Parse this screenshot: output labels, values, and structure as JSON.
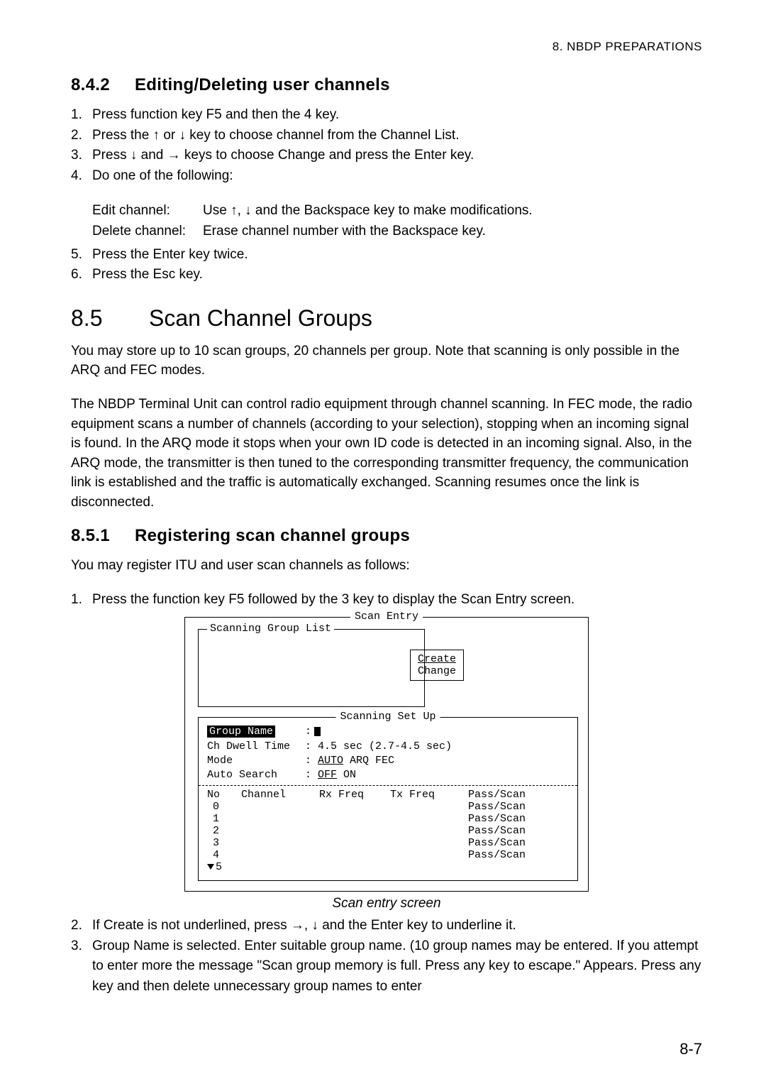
{
  "header": {
    "right": "8.  NBDP  PREPARATIONS"
  },
  "section842": {
    "num": "8.4.2",
    "title": "Editing/Deleting user channels",
    "steps": {
      "s1n": "1.",
      "s1t": "Press function key F5 and then the 4 key.",
      "s2n": "2.",
      "s2t": "Press the ↑ or ↓ key to choose channel from the Channel List.",
      "s3n": "3.",
      "s3t": "Press ↓ and → keys to choose Change and press the Enter key.",
      "s4n": "4.",
      "s4t": "Do one of the following:",
      "s5n": "5.",
      "s5t": "Press the Enter key twice.",
      "s6n": "6.",
      "s6t": "Press the Esc key."
    },
    "detail": {
      "edit_lbl": "Edit channel:",
      "edit_txt": "Use ↑, ↓ and the Backspace key to make modifications.",
      "del_lbl": "Delete channel:",
      "del_txt": "Erase channel number with the Backspace key."
    }
  },
  "section85": {
    "num": "8.5",
    "title": "Scan Channel Groups",
    "para1": "You may store up to 10 scan groups, 20 channels per group. Note that scanning is only possible in the ARQ and FEC modes.",
    "para2": "The NBDP Terminal Unit can control radio equipment through channel scanning. In FEC mode, the radio equipment scans a number of channels (according to your selection), stopping when an incoming signal is found. In the ARQ mode it stops when your own ID code is detected in an incoming signal. Also, in the ARQ mode, the transmitter is then tuned to the corresponding transmitter frequency, the communication link is established and the traffic is automatically exchanged. Scanning resumes once the link is disconnected."
  },
  "section851": {
    "num": "8.5.1",
    "title": "Registering scan channel groups",
    "intro": "You may register ITU and user scan channels as follows:",
    "steps": {
      "s1n": "1.",
      "s1t": "Press the function key F5 followed by the 3 key to display the Scan Entry screen.",
      "s2n": "2.",
      "s2t": "If Create is not underlined, press →, ↓ and the Enter key to underline it.",
      "s3n": "3.",
      "s3t": "Group Name is selected. Enter suitable group name. (10 group names may be entered. If you attempt to enter more the message \"Scan group memory is full. Press any key to escape.\" Appears. Press any key and then delete unnecessary group names to enter"
    }
  },
  "scan_entry": {
    "box_title": "Scan Entry",
    "group_list_title": "Scanning Group List",
    "create": "Create",
    "change": "Change",
    "setup_title": "Scanning Set Up",
    "group_name_lbl": "Group Name",
    "dwell_lbl": "Ch Dwell Time",
    "dwell_val": ": 4.5 sec (2.7-4.5 sec)",
    "mode_lbl": "Mode",
    "mode_colon": ": ",
    "mode_auto": "AUTO",
    "mode_rest": " ARQ FEC",
    "autosearch_lbl": "Auto Search",
    "autosearch_colon": ": ",
    "autosearch_off": "OFF",
    "autosearch_rest": " ON",
    "th_no": "No",
    "th_channel": "Channel",
    "th_rx": "Rx Freq",
    "th_tx": "Tx Freq",
    "th_ps": "Pass/Scan",
    "rows": [
      {
        "n": "0",
        "ps": "Pass/Scan"
      },
      {
        "n": "1",
        "ps": "Pass/Scan"
      },
      {
        "n": "2",
        "ps": "Pass/Scan"
      },
      {
        "n": "3",
        "ps": "Pass/Scan"
      },
      {
        "n": "4",
        "ps": "Pass/Scan"
      }
    ],
    "row5": "5",
    "caption": "Scan entry screen"
  },
  "page": "8-7"
}
